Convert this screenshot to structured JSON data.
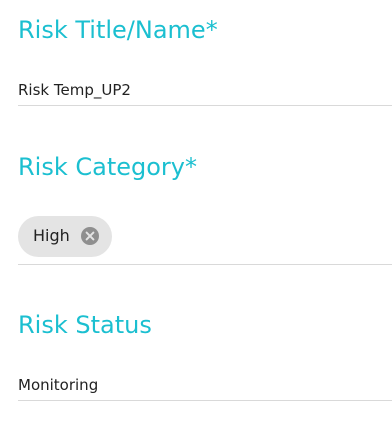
{
  "fields": {
    "title": {
      "label": "Risk Title/Name*",
      "value": "Risk Temp_UP2"
    },
    "category": {
      "label": "Risk Category*",
      "chip": {
        "label": "High",
        "remove_icon": "close-circle-icon"
      }
    },
    "status": {
      "label": "Risk Status",
      "value": "Monitoring"
    }
  },
  "colors": {
    "label": "#1bbfd0",
    "value_text": "#222222",
    "underline": "#d9d9d9",
    "chip_background": "#e4e4e4",
    "chip_remove_icon": "#8f8f8f"
  }
}
